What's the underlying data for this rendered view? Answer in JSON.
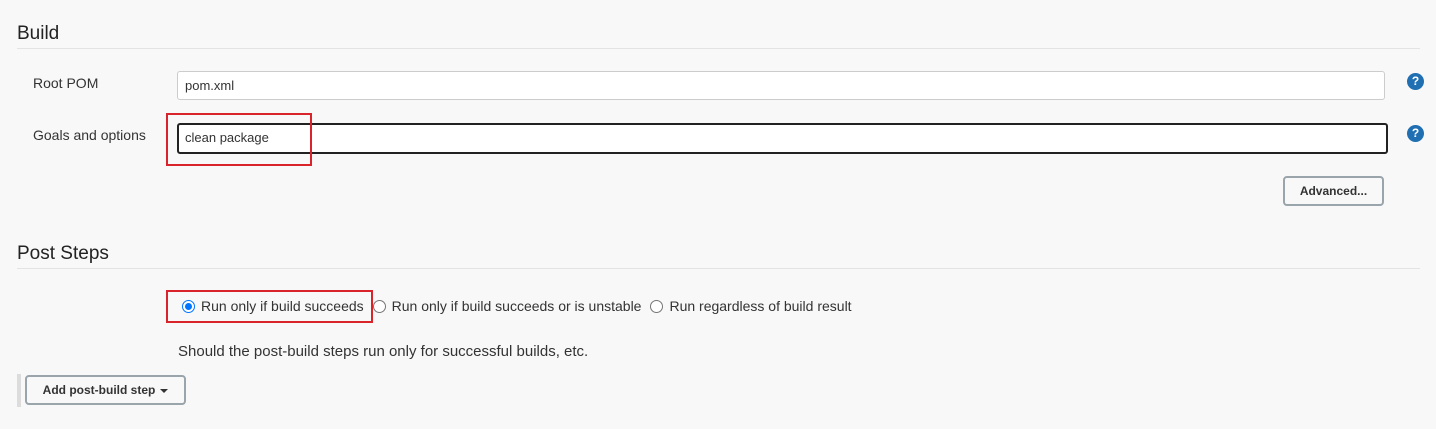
{
  "build": {
    "title": "Build",
    "root_pom": {
      "label": "Root POM",
      "value": "pom.xml"
    },
    "goals": {
      "label": "Goals and options",
      "value": "clean package"
    },
    "help_glyph": "?",
    "advanced_label": "Advanced..."
  },
  "post_steps": {
    "title": "Post Steps",
    "options": [
      {
        "label": "Run only if build succeeds",
        "selected": true
      },
      {
        "label": "Run only if build succeeds or is unstable",
        "selected": false
      },
      {
        "label": "Run regardless of build result",
        "selected": false
      }
    ],
    "description": "Should the post-build steps run only for successful builds, etc.",
    "add_button_label": "Add post-build step"
  },
  "colors": {
    "highlight": "#d9242b",
    "help_icon": "#1f6fb2",
    "radio_checked": "#0075ff"
  }
}
